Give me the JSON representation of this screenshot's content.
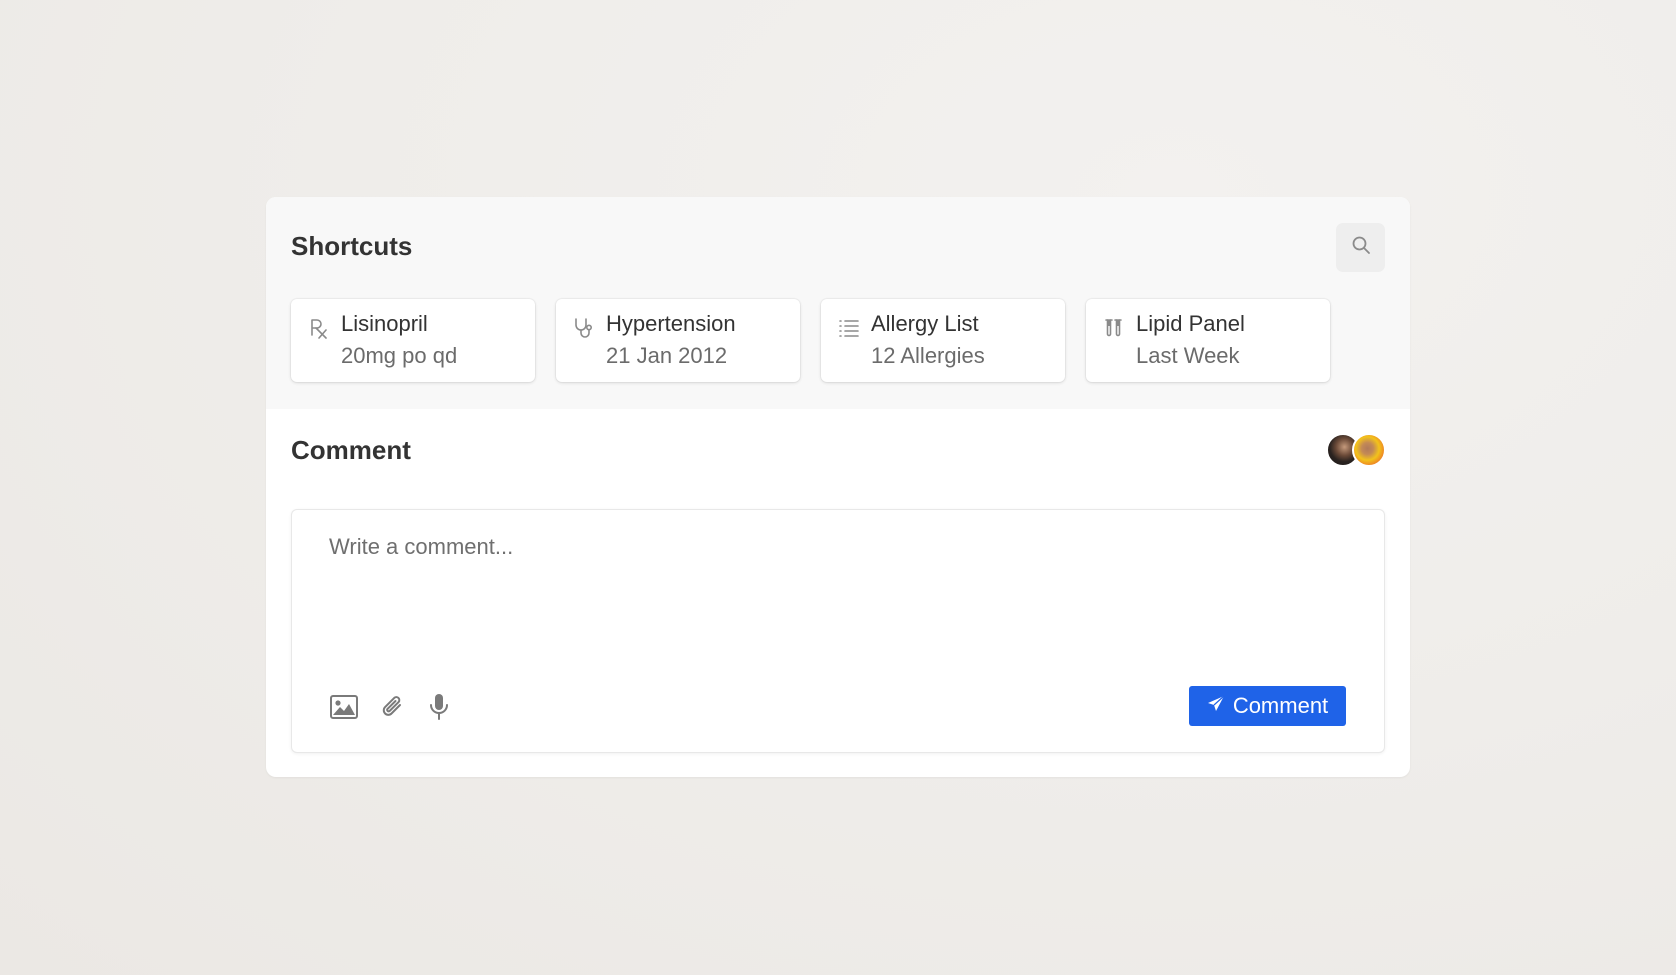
{
  "colors": {
    "accent": "#1f63e8",
    "panel_bg": "#f8f8f8",
    "card_bg": "#ffffff",
    "text_primary": "#333333",
    "text_secondary": "#6b6b6b"
  },
  "shortcuts": {
    "title": "Shortcuts",
    "search_icon": "search-icon",
    "items": [
      {
        "icon": "rx-icon",
        "name": "Lisinopril",
        "detail": "20mg po qd"
      },
      {
        "icon": "stethoscope-icon",
        "name": "Hypertension",
        "detail": "21 Jan 2012"
      },
      {
        "icon": "list-icon",
        "name": "Allergy List",
        "detail": "12 Allergies"
      },
      {
        "icon": "test-tubes-icon",
        "name": "Lipid Panel",
        "detail": "Last Week"
      }
    ]
  },
  "comment": {
    "title": "Comment",
    "avatars": [
      "avatar-1",
      "avatar-2"
    ],
    "placeholder": "Write a comment...",
    "tools": [
      "image-icon",
      "paperclip-icon",
      "microphone-icon"
    ],
    "submit_label": "Comment",
    "submit_icon": "send-icon"
  }
}
